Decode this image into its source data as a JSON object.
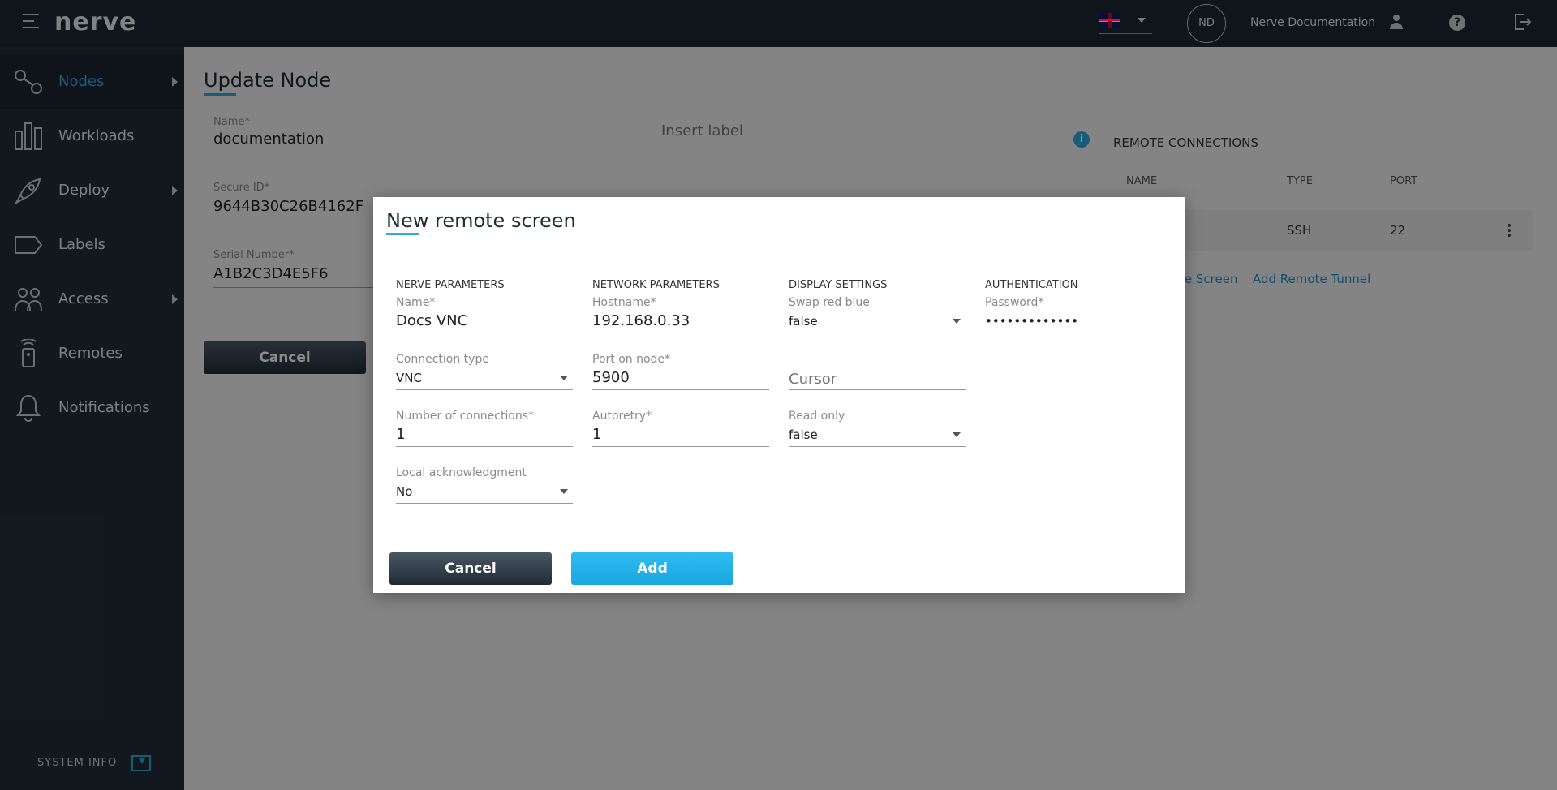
{
  "topbar": {
    "logo": "nerve",
    "avatar_initials": "ND",
    "username": "Nerve Documentation"
  },
  "sidebar": {
    "items": [
      {
        "label": "Nodes",
        "icon": "nodes-icon",
        "active": true,
        "has_arrow": true
      },
      {
        "label": "Workloads",
        "icon": "workloads-icon",
        "active": false,
        "has_arrow": false
      },
      {
        "label": "Deploy",
        "icon": "rocket-icon",
        "active": false,
        "has_arrow": true
      },
      {
        "label": "Labels",
        "icon": "label-icon",
        "active": false,
        "has_arrow": false
      },
      {
        "label": "Access",
        "icon": "users-icon",
        "active": false,
        "has_arrow": true
      },
      {
        "label": "Remotes",
        "icon": "remote-icon",
        "active": false,
        "has_arrow": false
      },
      {
        "label": "Notifications",
        "icon": "bell-icon",
        "active": false,
        "has_arrow": false
      }
    ],
    "system_info": "SYSTEM INFO"
  },
  "page": {
    "title": "Update Node",
    "name_label": "Name*",
    "name_value": "documentation",
    "label_placeholder": "Insert label",
    "secure_id_label": "Secure ID*",
    "secure_id_value": "9644B30C26B4162F",
    "serial_label": "Serial Number*",
    "serial_value": "A1B2C3D4E5F6",
    "cancel": "Cancel",
    "remote_connections": {
      "title": "REMOTE CONNECTIONS",
      "headers": [
        "NAME",
        "TYPE",
        "PORT"
      ],
      "rows": [
        {
          "name": "",
          "type": "SSH",
          "port": "22"
        }
      ],
      "add_screen": "te Screen",
      "add_tunnel": "Add Remote Tunnel"
    }
  },
  "modal": {
    "title": "New remote screen",
    "sections": {
      "nerve": "NERVE PARAMETERS",
      "network": "NETWORK PARAMETERS",
      "display": "DISPLAY SETTINGS",
      "auth": "AUTHENTICATION"
    },
    "fields": {
      "name": {
        "label": "Name*",
        "value": "Docs VNC"
      },
      "connection_type": {
        "label": "Connection type",
        "value": "VNC"
      },
      "num_connections": {
        "label": "Number of connections*",
        "value": "1"
      },
      "local_ack": {
        "label": "Local acknowledgment",
        "value": "No"
      },
      "hostname": {
        "label": "Hostname*",
        "value": "192.168.0.33"
      },
      "port": {
        "label": "Port on node*",
        "value": "5900"
      },
      "autoretry": {
        "label": "Autoretry*",
        "value": "1"
      },
      "swap_red_blue": {
        "label": "Swap red blue",
        "value": "false"
      },
      "cursor": {
        "placeholder": "Cursor"
      },
      "read_only": {
        "label": "Read only",
        "value": "false"
      },
      "password": {
        "label": "Password*",
        "value": "•••••••••••••"
      }
    },
    "cancel": "Cancel",
    "add": "Add"
  },
  "colors": {
    "accent": "#2ea8dd",
    "topbar": "#1d2731",
    "sidebar": "#222d37"
  }
}
